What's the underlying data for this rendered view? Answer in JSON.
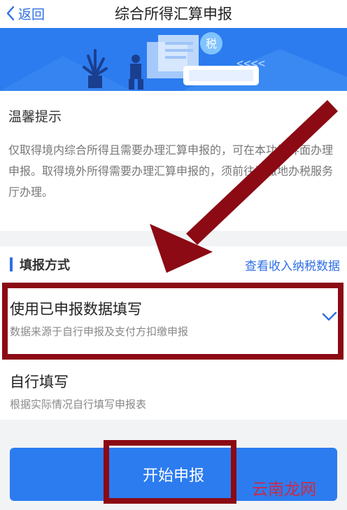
{
  "nav": {
    "back_label": "返回",
    "title": "综合所得汇算申报"
  },
  "banner": {
    "tax_glyph": "税",
    "arrows": "<<<<"
  },
  "notice": {
    "title": "温馨提示",
    "body": "仅取得境内综合所得且需要办理汇算申报的，可在本功能界面办理申报。取得境外所得需要办理汇算申报的，须前往汇缴地办税服务厅办理。"
  },
  "method": {
    "label": "填报方式",
    "link": "查看收入纳税数据",
    "options": [
      {
        "title": "使用已申报数据填写",
        "desc": "数据来源于自行申报及支付方扣缴申报",
        "selected": true
      },
      {
        "title": "自行填写",
        "desc": "根据实际情况自行填写申报表",
        "selected": false
      }
    ]
  },
  "start_button": "开始申报",
  "watermark": "云南龙网",
  "colors": {
    "brand_blue": "#2f6fe5",
    "button_blue": "#2c7cf0",
    "annotation_red": "#8b0a14"
  }
}
